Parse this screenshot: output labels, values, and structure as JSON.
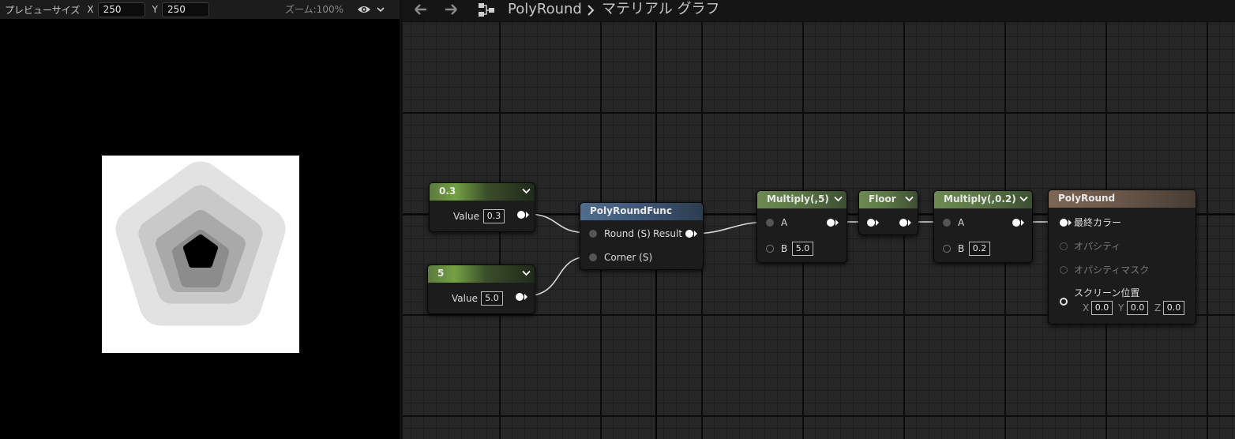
{
  "preview": {
    "size_label": "プレビューサイズ",
    "x_label": "X",
    "x_value": "250",
    "y_label": "Y",
    "y_value": "250",
    "zoom_label": "ズーム:100%"
  },
  "breadcrumb": {
    "asset": "PolyRound",
    "graph": "マテリアル グラフ"
  },
  "nodes": {
    "const_a": {
      "title": "0.3",
      "pin_label": "Value",
      "value": "0.3"
    },
    "const_b": {
      "title": "5",
      "pin_label": "Value",
      "value": "5.0"
    },
    "func": {
      "title": "PolyRoundFunc",
      "in1": "Round (S)",
      "in2": "Corner (S)",
      "out": "Result"
    },
    "mul1": {
      "title": "Multiply(,5)",
      "a": "A",
      "b": "B",
      "b_value": "5.0"
    },
    "floor": {
      "title": "Floor"
    },
    "mul2": {
      "title": "Multiply(,0.2)",
      "a": "A",
      "b": "B",
      "b_value": "0.2"
    },
    "result": {
      "title": "PolyRound",
      "final_color": "最終カラー",
      "opacity": "オパシティ",
      "opacity_mask": "オパシティマスク",
      "screen_pos": "スクリーン位置",
      "x_label": "X",
      "x_value": "0.0",
      "y_label": "Y",
      "y_value": "0.0",
      "z_label": "Z",
      "z_value": "0.0"
    }
  },
  "colors": {
    "graph_bg": "#262626",
    "scalar_header": "#73a044",
    "function_header": "#506d8d",
    "math_header": "#6d8a55",
    "result_header": "#7c6756"
  }
}
